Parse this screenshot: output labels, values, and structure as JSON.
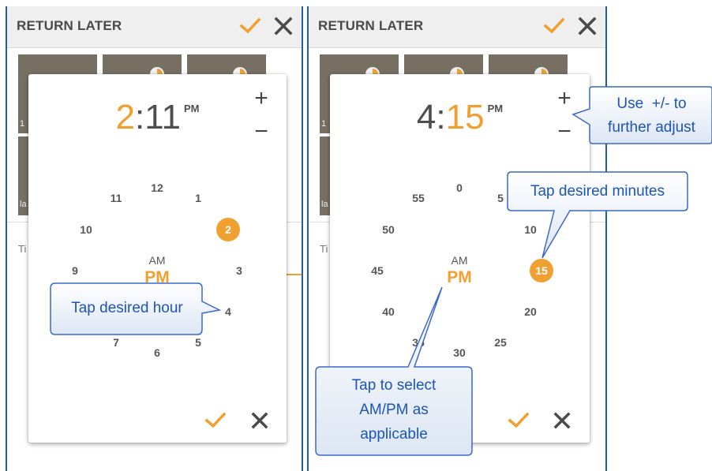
{
  "panels": [
    {
      "title": "RETURN LATER",
      "background": {
        "thumb_labels": [
          "1",
          "la"
        ],
        "field_label": "Ti"
      },
      "dialog": {
        "time": {
          "hour": "2",
          "separator": ":",
          "minute": "11",
          "ampm": "PM"
        },
        "plus": "+",
        "minus": "−",
        "dial": [
          "12",
          "1",
          "2",
          "3",
          "4",
          "5",
          "6",
          "7",
          "9",
          "10",
          "11"
        ],
        "selected": "2",
        "am": "AM",
        "pm": "PM"
      },
      "callouts": [
        {
          "text": "Tap desired hour"
        }
      ]
    },
    {
      "title": "RETURN LATER",
      "background": {
        "thumb_labels": [
          "1",
          "la"
        ],
        "field_label": "Ti"
      },
      "dialog": {
        "time": {
          "hour": "4",
          "separator": ":",
          "minute": "15",
          "ampm": "PM"
        },
        "plus": "+",
        "minus": "−",
        "dial": [
          "0",
          "5",
          "10",
          "15",
          "20",
          "25",
          "30",
          "35",
          "40",
          "45",
          "50",
          "55"
        ],
        "selected": "15",
        "am": "AM",
        "pm": "PM"
      },
      "callouts": [
        {
          "text_line1": "Use  +/- to",
          "text_line2": "further adjust"
        },
        {
          "text": "Tap desired minutes"
        },
        {
          "text_line1": "Tap to select",
          "text_line2": "AM/PM as",
          "text_line3": "applicable"
        }
      ]
    }
  ],
  "icons": {
    "check": "check-icon",
    "close": "close-icon",
    "plus": "plus-icon",
    "minus": "minus-icon"
  },
  "colors": {
    "accent": "#f0a030",
    "frame": "#1f5fa8",
    "callout_text": "#1c55b5",
    "callout_border": "#3b68c9"
  }
}
